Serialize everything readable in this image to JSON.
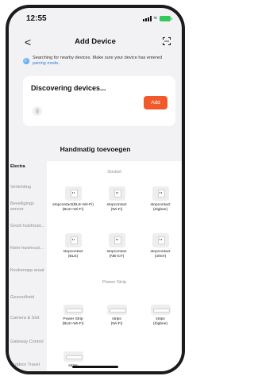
{
  "status": {
    "time": "12:55"
  },
  "nav": {
    "back_label": "<",
    "title": "Add Device",
    "scan_icon": "scan-icon"
  },
  "hint": {
    "text": "Searching for nearby devices. Make sure your device has entered ",
    "link": "pairing mode",
    "tail": "."
  },
  "discover": {
    "title": "Discovering devices...",
    "add_label": "Add"
  },
  "section_title": "Handmatig toevoegen",
  "sidebar": {
    "items": [
      {
        "label": "Electra",
        "active": true
      },
      {
        "label": "Verlichting",
        "active": false
      },
      {
        "label": "Beveiligings sensor",
        "active": false
      },
      {
        "label": "Groot huishoud...",
        "active": false
      },
      {
        "label": "Klein huishoud...",
        "active": false
      },
      {
        "label": "Keukenapp araat",
        "active": false
      },
      {
        "label": "Gezondheid",
        "active": false
      },
      {
        "label": "Camera & Slot",
        "active": false
      },
      {
        "label": "Gateway Control",
        "active": false
      },
      {
        "label": "Outdoor Travel",
        "active": false
      }
    ]
  },
  "categories": [
    {
      "heading": "Socket",
      "devices": [
        {
          "label": "stopcontact(BLE+Wi-Fi)\n(BLE+Wi-Fi)",
          "icon": "plug-icon"
        },
        {
          "label": "stopcontact\n(Wi-Fi)",
          "icon": "plug-icon"
        },
        {
          "label": "stopcontact\n(Zigbee)",
          "icon": "plug-icon"
        },
        {
          "label": "stopcontact\n(BLE)",
          "icon": "plug-icon"
        },
        {
          "label": "stopcontact\n(NB-IoT)",
          "icon": "plug-icon"
        },
        {
          "label": "stopcontact\n(other)",
          "icon": "plug-icon"
        }
      ]
    },
    {
      "heading": "Power Strip",
      "devices": [
        {
          "label": "Power Strip\n(BLE+Wi-Fi)",
          "icon": "power-strip-icon"
        },
        {
          "label": "strips\n(Wi-Fi)",
          "icon": "power-strip-icon"
        },
        {
          "label": "strips\n(Zigbee)",
          "icon": "power-strip-icon"
        },
        {
          "label": "strips",
          "icon": "power-strip-icon"
        }
      ]
    }
  ],
  "colors": {
    "accent": "#f1592a",
    "link": "#2f7bdc",
    "battery": "#34c759"
  }
}
